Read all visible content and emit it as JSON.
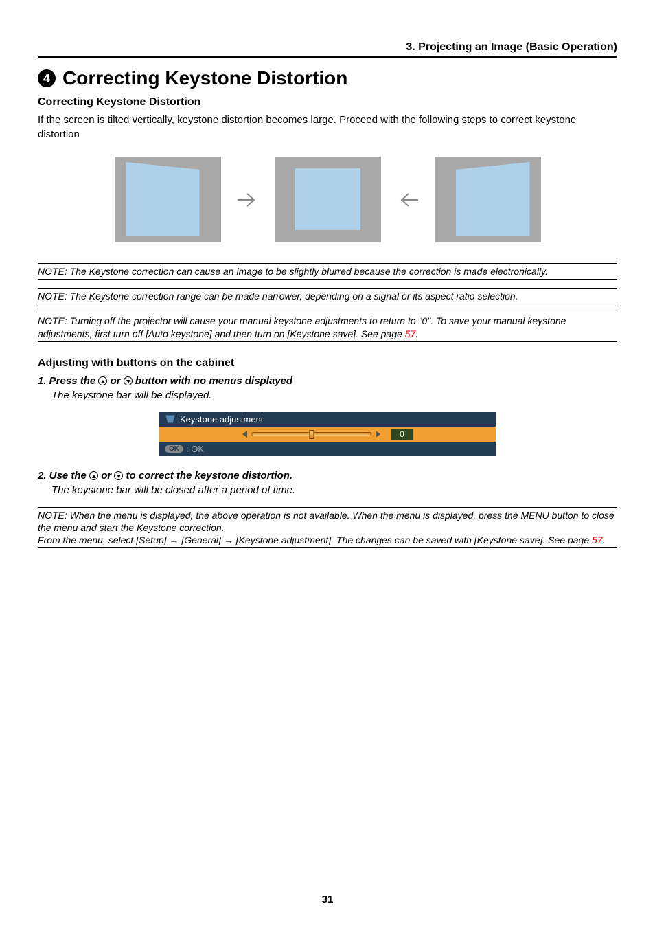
{
  "sectionHeader": "3. Projecting an Image (Basic Operation)",
  "titleNumber": "4",
  "mainTitle": "Correcting Keystone Distortion",
  "subHeading1": "Correcting Keystone Distortion",
  "bodyText": "If the screen is tilted vertically, keystone distortion becomes large. Proceed with the following steps to correct keystone distortion",
  "note1": "NOTE: The Keystone correction can cause an image to be slightly blurred because the correction is made electronically.",
  "note2": "NOTE: The Keystone correction range can be made narrower, depending on a signal or its aspect ratio selection.",
  "note3_a": "NOTE: Turning off the projector will cause your manual keystone adjustments to return to \"0\". To save your manual keystone adjustments, first turn off [Auto keystone] and then turn on [Keystone save]. See page ",
  "note3_link": "57",
  "note3_b": ".",
  "subHeading2": "Adjusting with buttons on the cabinet",
  "step1_a": "1.  Press the ",
  "step1_mid": " or ",
  "step1_b": " button with no menus displayed",
  "step1_desc": "The keystone bar will be displayed.",
  "keystone_label": "Keystone adjustment",
  "keystone_value": "0",
  "keystone_ok": "OK",
  "ok_label": ": OK",
  "step2_a": "2.  Use the ",
  "step2_mid": " or ",
  "step2_b": " to correct the keystone distortion.",
  "step2_desc": "The keystone bar will be closed after a period of time.",
  "note4_a": "NOTE: When the menu is displayed, the above operation is not available. When the menu is displayed, press the MENU button to close the menu and start the Keystone correction.",
  "note4_b_1": "From the menu, select [Setup] ",
  "note4_b_2": " [General] ",
  "note4_b_3": " [Keystone adjustment]. The changes can be saved with [Keystone save]. See page ",
  "note4_link": "57",
  "note4_b_4": ".",
  "arrow": "→",
  "pageNum": "31"
}
